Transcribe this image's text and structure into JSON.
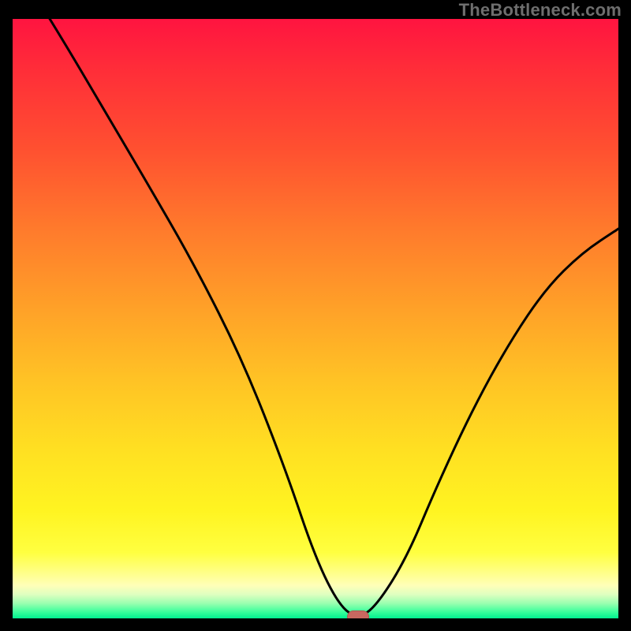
{
  "watermark": "TheBottleneck.com",
  "chart_data": {
    "type": "line",
    "title": "",
    "xlabel": "",
    "ylabel": "",
    "xlim": [
      0,
      100
    ],
    "ylim": [
      0,
      100
    ],
    "background_gradient": {
      "top": "#ff1440",
      "mid": "#ffe022",
      "bottom": "#00f090"
    },
    "x": [
      0,
      8,
      15,
      22,
      30,
      38,
      45,
      50,
      54,
      57,
      60,
      65,
      70,
      76,
      82,
      88,
      94,
      100
    ],
    "values": [
      110,
      97,
      85,
      73,
      59,
      43,
      25,
      10,
      2,
      0,
      2,
      10,
      22,
      35,
      46,
      55,
      61,
      65
    ],
    "marker": {
      "x": 57,
      "y": 0
    },
    "annotations": []
  },
  "marker_color": "#c86860"
}
